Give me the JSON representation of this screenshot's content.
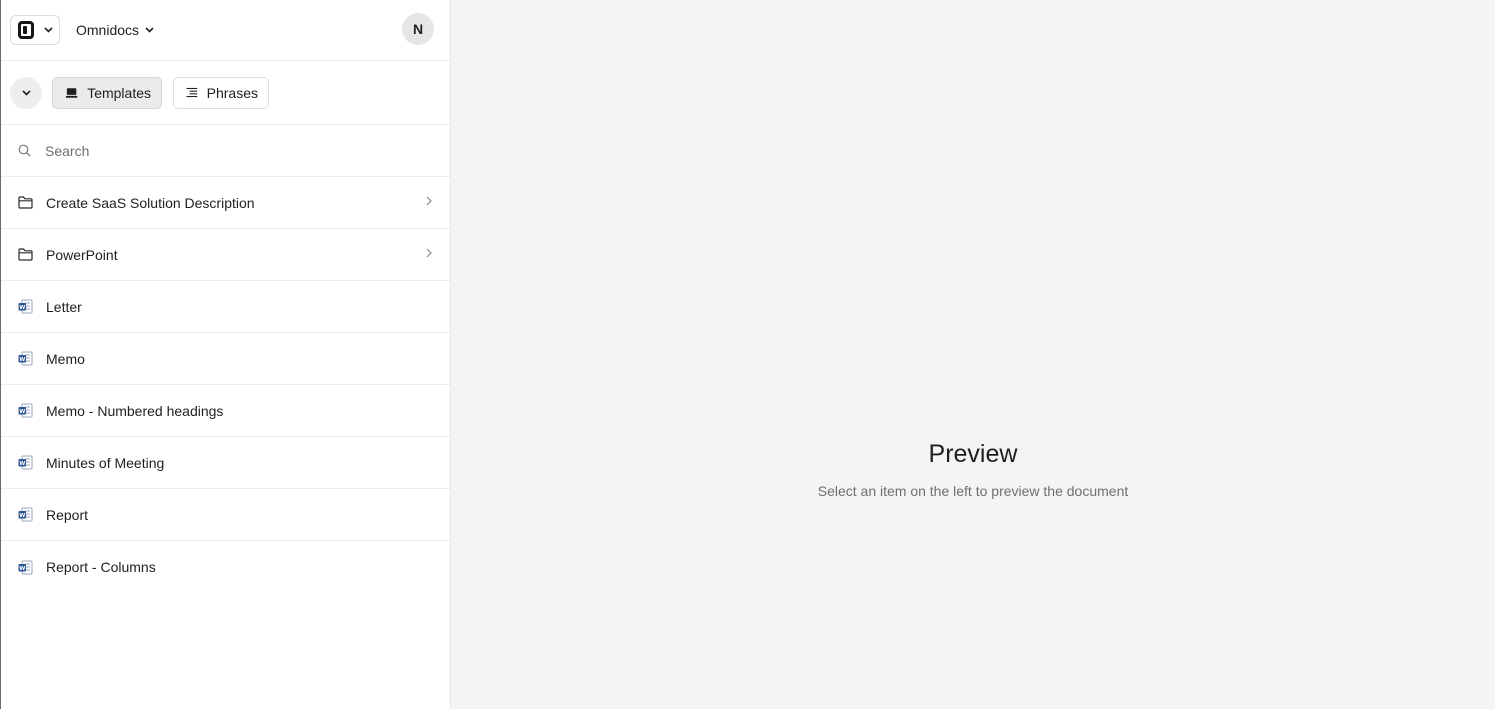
{
  "header": {
    "workspace_name": "Omnidocs",
    "avatar_initial": "N"
  },
  "tabs": [
    {
      "label": "Templates",
      "active": true,
      "icon": "stack-icon"
    },
    {
      "label": "Phrases",
      "active": false,
      "icon": "list-icon"
    }
  ],
  "search": {
    "placeholder": "Search",
    "value": ""
  },
  "items": [
    {
      "label": "Create SaaS Solution Description",
      "type": "folder"
    },
    {
      "label": "PowerPoint",
      "type": "folder"
    },
    {
      "label": "Letter",
      "type": "word-document"
    },
    {
      "label": "Memo",
      "type": "word-document"
    },
    {
      "label": "Memo - Numbered headings",
      "type": "word-document"
    },
    {
      "label": "Minutes of Meeting",
      "type": "word-document"
    },
    {
      "label": "Report",
      "type": "word-document"
    },
    {
      "label": "Report - Columns",
      "type": "word-document"
    }
  ],
  "preview": {
    "title": "Preview",
    "subtitle": "Select an item on the left to preview the document"
  },
  "colors": {
    "word_blue": "#2b5797",
    "background": "#f4f4f4",
    "sidebar": "#ffffff"
  }
}
